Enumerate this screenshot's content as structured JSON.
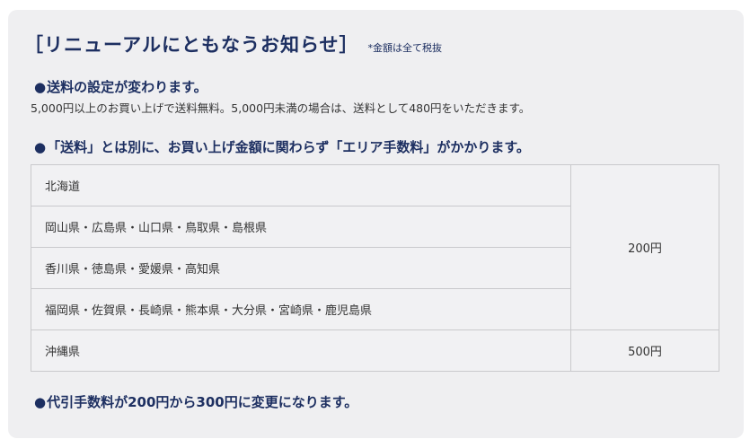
{
  "header": {
    "title": "［リニューアルにともなうお知らせ］",
    "note": "*金額は全て税抜"
  },
  "sections": {
    "shipping": {
      "bullet": "●",
      "heading": "送料の設定が変わります。",
      "description": "5,000円以上のお買い上げで送料無料。5,000円未満の場合は、送料として480円をいただきます。"
    },
    "area_fee": {
      "bullet": "●",
      "heading": "「送料」とは別に、お買い上げ金額に関わらず「エリア手数料」がかかります。"
    },
    "cod": {
      "bullet": "●",
      "heading": "代引手数料が200円から300円に変更になります。"
    }
  },
  "area_fee_table": {
    "rows": [
      "北海道",
      "岡山県・広島県・山口県・鳥取県・島根県",
      "香川県・徳島県・愛媛県・高知県",
      "福岡県・佐賀県・長崎県・熊本県・大分県・宮崎県・鹿児島県",
      "沖縄県"
    ],
    "fees": [
      "200円",
      "500円"
    ]
  },
  "colors": {
    "heading": "#1d2f61",
    "body_text": "#333333",
    "panel_bg": "#efeff1",
    "border": "#c9c9cc"
  }
}
